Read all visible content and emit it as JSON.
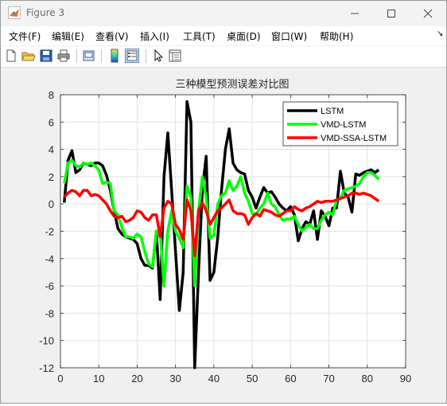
{
  "window": {
    "title": "Figure 3"
  },
  "menu": [
    "文件(F)",
    "编辑(E)",
    "查看(V)",
    "插入(I)",
    "工具(T)",
    "桌面(D)",
    "窗口(W)",
    "帮助(H)"
  ],
  "toolbar": [
    "new-figure",
    "open-file",
    "save",
    "print",
    "print-preview",
    "colorbar",
    "legend",
    "pointer",
    "property-inspector"
  ],
  "chart_data": {
    "type": "line",
    "title": "三种模型预测误差对比图",
    "xlabel": "",
    "ylabel": "",
    "xlim": [
      0,
      90
    ],
    "ylim": [
      -12,
      8
    ],
    "xticks": [
      0,
      10,
      20,
      30,
      40,
      50,
      60,
      70,
      80,
      90
    ],
    "yticks": [
      8,
      6,
      4,
      2,
      0,
      -2,
      -4,
      -6,
      -8,
      -10,
      -12
    ],
    "grid": true,
    "legend_position": "top-right",
    "x": [
      1,
      2,
      3,
      4,
      5,
      6,
      7,
      8,
      9,
      10,
      11,
      12,
      13,
      14,
      15,
      16,
      17,
      18,
      19,
      20,
      21,
      22,
      23,
      24,
      25,
      26,
      27,
      28,
      29,
      30,
      31,
      32,
      33,
      34,
      35,
      36,
      37,
      38,
      39,
      40,
      41,
      42,
      43,
      44,
      45,
      46,
      47,
      48,
      49,
      50,
      51,
      52,
      53,
      54,
      55,
      56,
      57,
      58,
      59,
      60,
      61,
      62,
      63,
      64,
      65,
      66,
      67,
      68,
      69,
      70,
      71,
      72,
      73,
      74,
      75,
      76,
      77,
      78,
      79,
      80,
      81,
      82,
      83
    ],
    "series": [
      {
        "name": "LSTM",
        "color": "#000000",
        "values": [
          0.1,
          3.2,
          3.9,
          2.3,
          2.5,
          3.0,
          2.9,
          2.8,
          3.0,
          3.0,
          2.8,
          2.1,
          1.0,
          -0.5,
          -1.8,
          -2.2,
          -2.4,
          -2.5,
          -2.6,
          -2.9,
          -4.0,
          -4.5,
          -4.5,
          -4.7,
          -2.0,
          -7.0,
          2.0,
          5.2,
          1.0,
          -3.5,
          -7.8,
          -5.0,
          7.5,
          6.0,
          -12.0,
          -5.0,
          1.0,
          3.5,
          -5.6,
          -5.0,
          -2.5,
          1.0,
          4.0,
          5.5,
          3.0,
          2.5,
          2.3,
          2.2,
          1.0,
          0.5,
          -0.3,
          0.5,
          1.2,
          0.8,
          0.9,
          0.5,
          0.0,
          -0.3,
          -0.5,
          -0.2,
          -0.8,
          -2.7,
          -1.8,
          -1.3,
          -1.5,
          -0.5,
          -2.6,
          -0.5,
          -0.9,
          -1.6,
          -0.3,
          -0.3,
          2.4,
          0.8,
          0.5,
          -0.6,
          2.2,
          2.1,
          2.3,
          2.4,
          2.5,
          2.3,
          2.5
        ]
      },
      {
        "name": "VMD-LSTM",
        "color": "#00ff00",
        "values": [
          1.5,
          3.0,
          3.2,
          2.8,
          2.7,
          3.0,
          2.9,
          3.0,
          2.8,
          2.5,
          1.5,
          1.6,
          1.5,
          -0.5,
          -0.8,
          -1.7,
          -2.4,
          -2.4,
          -2.5,
          -2.2,
          -2.4,
          -3.5,
          -4.4,
          -4.6,
          -2.0,
          -2.1,
          -6.0,
          -2.0,
          -0.5,
          -2.0,
          -2.5,
          -3.2,
          1.3,
          0.5,
          -6.0,
          -0.5,
          2.0,
          0.5,
          -2.5,
          -2.3,
          0.0,
          0.6,
          0.8,
          1.7,
          1.0,
          1.3,
          2.0,
          0.8,
          0.2,
          -0.7,
          -0.8,
          -0.3,
          0.0,
          0.8,
          0.0,
          -0.2,
          -0.8,
          -1.2,
          -1.1,
          -1.1,
          -0.9,
          -1.5,
          -2.0,
          -1.7,
          -1.5,
          -1.8,
          -1.8,
          -1.2,
          -0.8,
          -0.6,
          -0.8,
          0.3,
          0.4,
          1.0,
          1.1,
          1.2,
          1.3,
          1.5,
          2.0,
          2.3,
          2.3,
          2.1,
          1.8
        ]
      },
      {
        "name": "VMD-SSA-LSTM",
        "color": "#ff0000",
        "values": [
          0.5,
          0.8,
          1.0,
          0.9,
          0.6,
          1.0,
          1.0,
          0.6,
          0.7,
          0.6,
          0.3,
          0.0,
          -0.5,
          -0.9,
          -1.0,
          -0.9,
          -1.3,
          -1.2,
          -1.0,
          -0.5,
          -0.6,
          -1.0,
          -1.2,
          -0.8,
          -0.8,
          -2.4,
          -0.3,
          0.2,
          0.0,
          -1.5,
          -1.9,
          -2.6,
          0.3,
          -0.5,
          -3.8,
          -0.5,
          0.1,
          -0.5,
          -1.5,
          -1.0,
          -0.5,
          -0.3,
          0.0,
          0.3,
          -0.5,
          -0.7,
          -0.7,
          -0.8,
          -1.5,
          -1.0,
          -0.7,
          -0.9,
          -0.4,
          -0.5,
          -0.6,
          -0.8,
          -0.9,
          -0.7,
          -0.5,
          -0.5,
          -0.2,
          -0.4,
          -0.5,
          -0.3,
          -0.2,
          0.0,
          0.2,
          0.1,
          0.2,
          0.2,
          0.2,
          0.3,
          0.4,
          0.5,
          0.6,
          0.8,
          0.8,
          0.7,
          0.8,
          0.7,
          0.6,
          0.4,
          0.2
        ]
      }
    ]
  }
}
